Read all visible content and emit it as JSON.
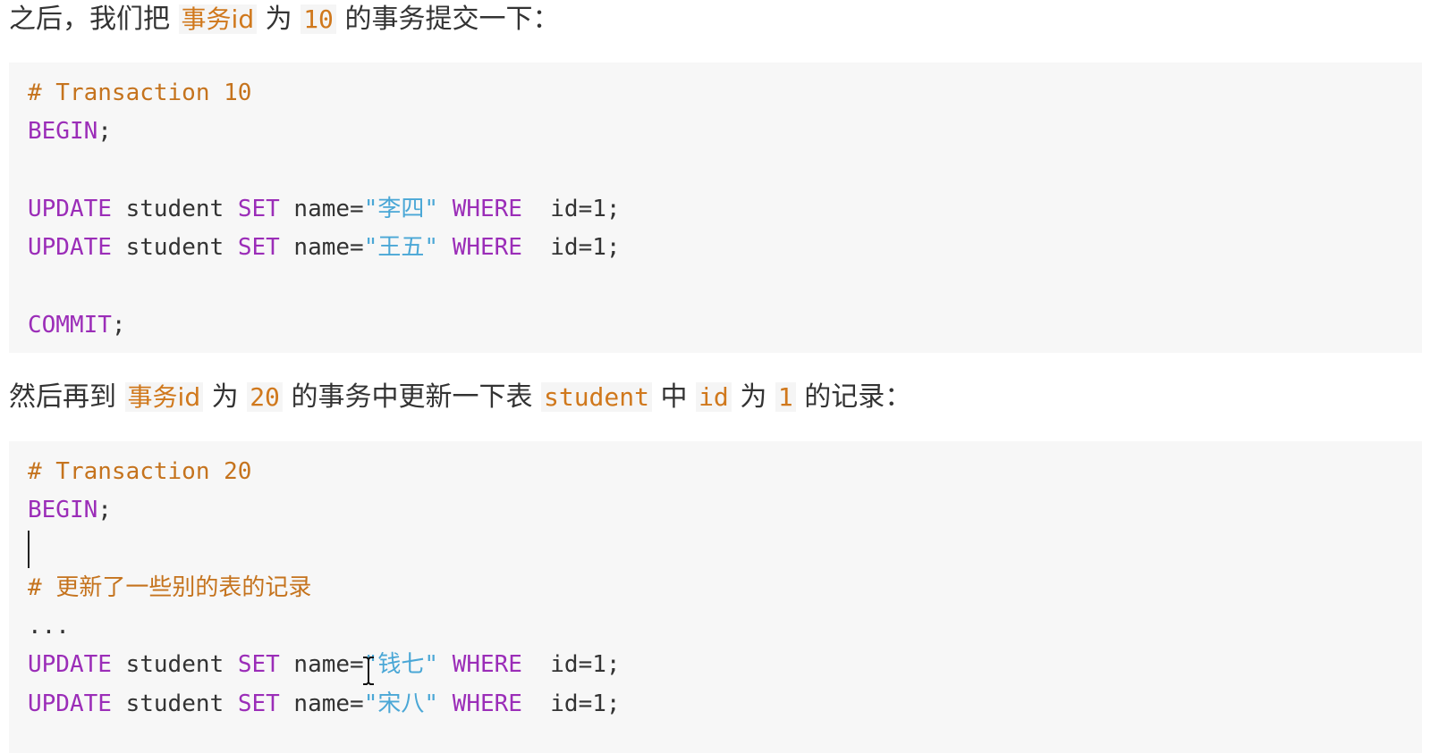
{
  "paragraph_1": {
    "t1": "之后，我们把 ",
    "c1": "事务id",
    "t2": " 为 ",
    "c2": "10",
    "t3": " 的事务提交一下："
  },
  "code_block_1": {
    "comment": "# Transaction 10",
    "begin_kw": "BEGIN",
    "begin_semi": ";",
    "update1": {
      "kw1": "UPDATE",
      "plain1": " student ",
      "kw2": "SET",
      "plain2": " name=",
      "q_open": "\"",
      "value": "李四",
      "q_close": "\"",
      "sp": " ",
      "kw3": "WHERE",
      "tail": "  id=1;"
    },
    "update2": {
      "kw1": "UPDATE",
      "plain1": " student ",
      "kw2": "SET",
      "plain2": " name=",
      "q_open": "\"",
      "value": "王五",
      "q_close": "\"",
      "sp": " ",
      "kw3": "WHERE",
      "tail": "  id=1;"
    },
    "commit_kw": "COMMIT",
    "commit_semi": ";"
  },
  "paragraph_2": {
    "t1": "然后再到 ",
    "c1": "事务id",
    "t2": " 为 ",
    "c2": "20",
    "t3": " 的事务中更新一下表 ",
    "c3": "student",
    "t4": " 中 ",
    "c4": "id",
    "t5": " 为 ",
    "c5": "1",
    "t6": " 的记录："
  },
  "code_block_2": {
    "comment": "# Transaction 20",
    "begin_kw": "BEGIN",
    "begin_semi": ";",
    "comment_cn_hash": "# ",
    "comment_cn_text": "更新了一些别的表的记录",
    "ellipsis": "...",
    "update1": {
      "kw1": "UPDATE",
      "plain1": " student ",
      "kw2": "SET",
      "plain2": " name=",
      "q_open": "\"",
      "value": "钱七",
      "q_close": "\"",
      "sp": " ",
      "kw3": "WHERE",
      "tail": "  id=1;"
    },
    "update2": {
      "kw1": "UPDATE",
      "plain1": " student ",
      "kw2": "SET",
      "plain2": " name=",
      "q_open": "\"",
      "value": "宋八",
      "q_close": "\"",
      "sp": " ",
      "kw3": "WHERE",
      "tail": "  id=1;"
    }
  },
  "colors": {
    "keyword": "#9b2db8",
    "comment": "#c5731d",
    "string": "#4aa7d6",
    "inline_code": "#d0781c",
    "code_background": "#f7f7f7"
  }
}
